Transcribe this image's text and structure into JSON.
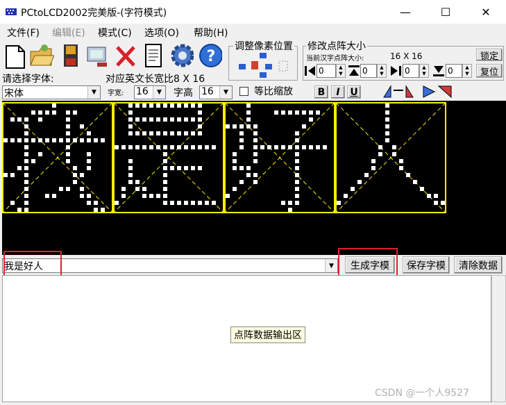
{
  "window": {
    "title": "PCtoLCD2002完美版-(字符模式)",
    "minimize": "—",
    "maximize": "☐",
    "close": "✕"
  },
  "menu": [
    {
      "label": "文件(F)",
      "disabled": false
    },
    {
      "label": "编辑(E)",
      "disabled": true
    },
    {
      "label": "模式(C)",
      "disabled": false
    },
    {
      "label": "选项(O)",
      "disabled": false
    },
    {
      "label": "帮助(H)",
      "disabled": false
    }
  ],
  "toolbar": {
    "icons": [
      "new-file-icon",
      "open-folder-icon",
      "save-disk-icon",
      "export-icon",
      "delete-icon",
      "document-icon",
      "settings-gear-icon",
      "help-icon"
    ],
    "help_glyph": "?"
  },
  "adjust": {
    "label": "调整像素位置"
  },
  "matrix_size": {
    "label": "修改点阵大小",
    "current_label": "当前汉字点阵大小:",
    "current_value": "16 X 16",
    "lock_button": "锁定",
    "reset_button": "复位",
    "spins": [
      "0",
      "0",
      "0",
      "0"
    ]
  },
  "font": {
    "select_label": "请选择字体:",
    "font_name": "宋体",
    "ratio_label": "对应英文长宽比8 X 16",
    "width_label": "字宽:",
    "width_value": "16",
    "height_label": "字高",
    "height_value": "16",
    "proportional_label": "等比缩放",
    "bold": "B",
    "italic": "I",
    "underline": "U"
  },
  "input": {
    "text": "我是好人",
    "generate_button": "生成字模",
    "save_button": "保存字模",
    "clear_button": "清除数据"
  },
  "output": {
    "hint": "点阵数据输出区"
  },
  "watermark": "CSDN @一个人9527"
}
